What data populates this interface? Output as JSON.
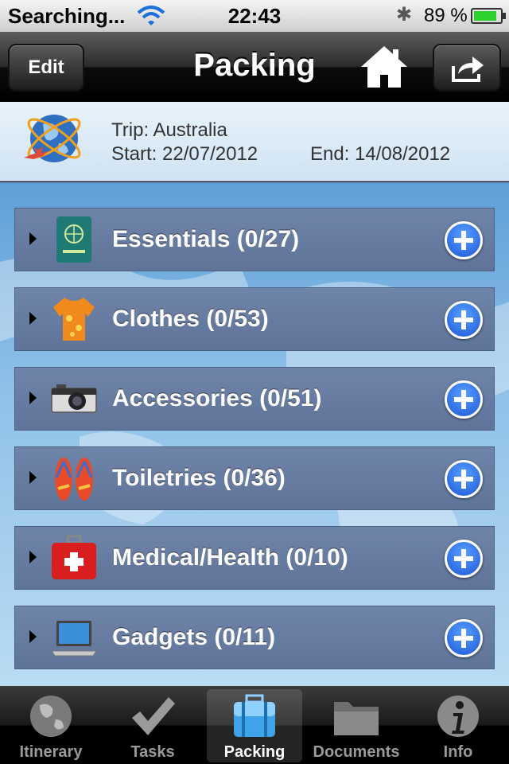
{
  "status": {
    "carrier": "Searching...",
    "time": "22:43",
    "battery_pct_text": "89 %",
    "battery_level": 0.89,
    "icons": [
      "wifi-icon",
      "bluetooth-icon",
      "battery-icon"
    ]
  },
  "nav": {
    "title": "Packing",
    "edit_label": "Edit",
    "icons": [
      "home-icon",
      "share-icon"
    ]
  },
  "trip": {
    "name": "Trip: Australia",
    "start": "Start: 22/07/2012",
    "end": "End: 14/08/2012",
    "icon": "globe-plane-icon"
  },
  "categories": [
    {
      "label": "Essentials (0/27)",
      "icon": "passport-icon"
    },
    {
      "label": "Clothes (0/53)",
      "icon": "shirt-icon"
    },
    {
      "label": "Accessories (0/51)",
      "icon": "camera-icon"
    },
    {
      "label": "Toiletries (0/36)",
      "icon": "flip-flops-icon"
    },
    {
      "label": "Medical/Health (0/10)",
      "icon": "first-aid-icon"
    },
    {
      "label": "Gadgets (0/11)",
      "icon": "laptop-icon"
    }
  ],
  "tabs": [
    {
      "label": "Itinerary",
      "icon": "globe-icon",
      "selected": false
    },
    {
      "label": "Tasks",
      "icon": "checkmark-icon",
      "selected": false
    },
    {
      "label": "Packing",
      "icon": "suitcase-icon",
      "selected": true
    },
    {
      "label": "Documents",
      "icon": "folder-icon",
      "selected": false
    },
    {
      "label": "Info",
      "icon": "info-icon",
      "selected": false
    }
  ],
  "colors": {
    "row_bg": "#6e84a8",
    "add_button": "#1d57d6",
    "selected_tab_text": "#ffffff"
  }
}
